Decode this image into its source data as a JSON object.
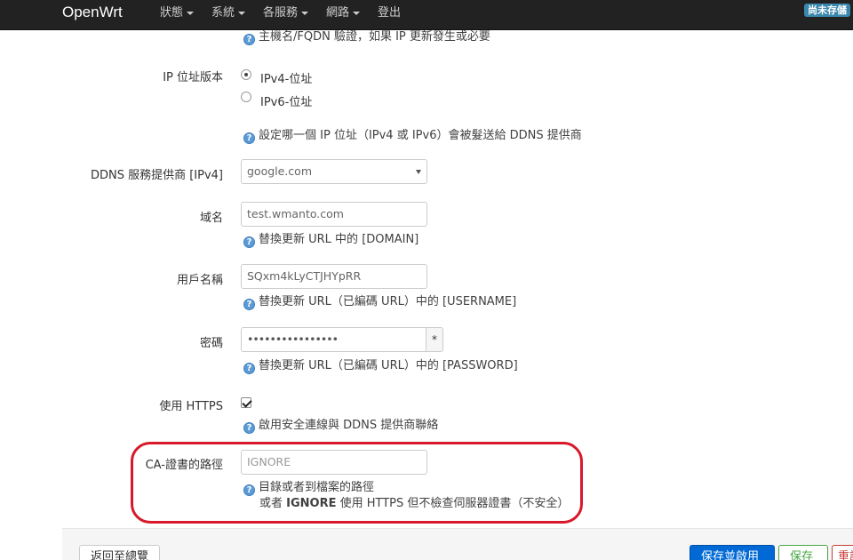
{
  "navbar": {
    "brand": "OpenWrt",
    "menu": [
      {
        "label": "狀態",
        "dropdown": true
      },
      {
        "label": "系統",
        "dropdown": true
      },
      {
        "label": "各服務",
        "dropdown": true
      },
      {
        "label": "網路",
        "dropdown": true
      },
      {
        "label": "登出",
        "dropdown": false
      }
    ],
    "unsaved_badge": "尚未存儲"
  },
  "form": {
    "hostname_help": "主機名/FQDN 驗證，如果 IP 更新發生或必要",
    "ip_version": {
      "label": "IP 位址版本",
      "options": [
        {
          "label": "IPv4-位址",
          "checked": true
        },
        {
          "label": "IPv6-位址",
          "checked": false
        }
      ],
      "help": "設定哪一個 IP 位址（IPv4 或 IPv6）會被髮送給 DDNS 提供商"
    },
    "ddns_provider": {
      "label": "DDNS 服務提供商 [IPv4]",
      "value": "google.com"
    },
    "domain": {
      "label": "域名",
      "value": "test.wmanto.com",
      "help": "替換更新 URL 中的 [DOMAIN]"
    },
    "username": {
      "label": "用戶名稱",
      "value": "SQxm4kLyCTJHYpRR",
      "help": "替換更新 URL（已編碼 URL）中的 [USERNAME]"
    },
    "password": {
      "label": "密碼",
      "value": "••••••••••••••••",
      "reveal": "*",
      "help": "替換更新 URL（已編碼 URL）中的 [PASSWORD]"
    },
    "use_https": {
      "label": "使用 HTTPS",
      "checked": true,
      "help": "啟用安全連線與 DDNS 提供商聯絡"
    },
    "ca_path": {
      "label": "CA-證書的路徑",
      "placeholder": "IGNORE",
      "help_line1": "目錄或者到檔案的路徑",
      "help_line2_prefix": "或者 ",
      "help_line2_bold": "IGNORE",
      "help_line2_suffix": " 使用 HTTPS 但不檢查伺服器證書（不安全）"
    }
  },
  "actions": {
    "back": "返回至總覽",
    "save_apply": "保存並啟用",
    "save": "保存",
    "reset": "重設"
  },
  "icons": {
    "help": "?"
  }
}
